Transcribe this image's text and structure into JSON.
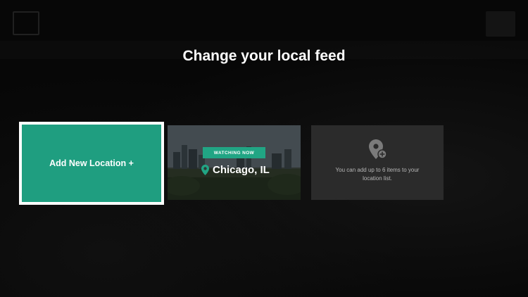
{
  "heading": "Change your local feed",
  "add_card": {
    "label": "Add New Location +"
  },
  "current_location_card": {
    "badge": "WATCHING NOW",
    "city": "Chicago, IL",
    "icon": "map-pin-icon"
  },
  "info_card": {
    "icon": "map-pin-plus-icon",
    "text": "You can add up to 6 items to your location list."
  },
  "colors": {
    "accent": "#1f9e80",
    "badge": "#21a584",
    "info_card_bg": "#2b2b2b"
  }
}
